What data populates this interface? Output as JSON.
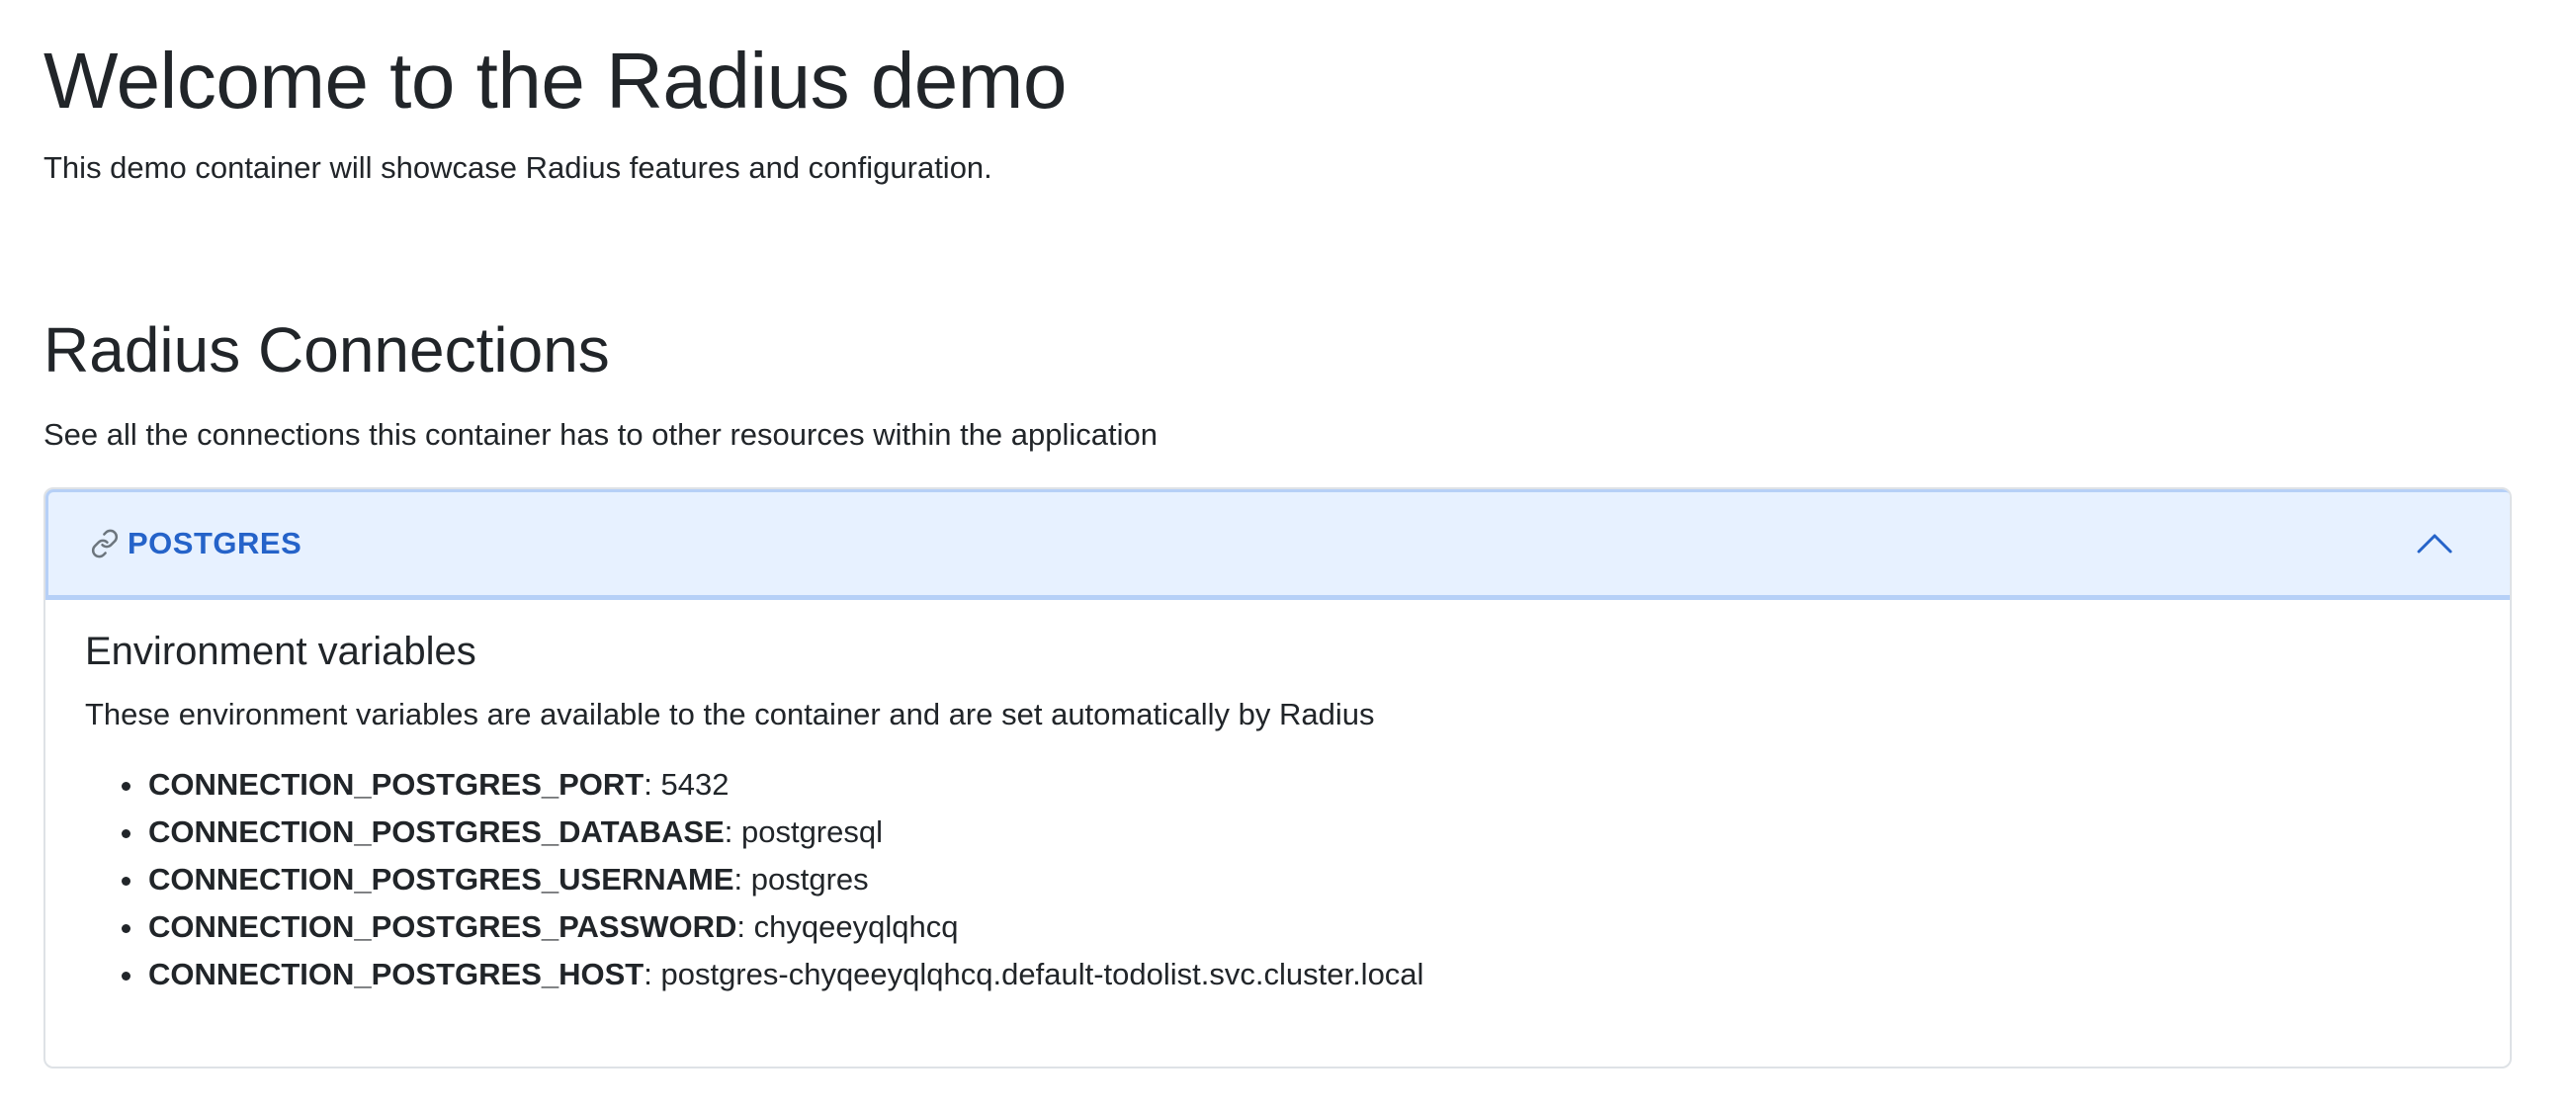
{
  "welcome": {
    "title": "Welcome to the Radius demo",
    "subtitle": "This demo container will showcase Radius features and configuration."
  },
  "connections": {
    "title": "Radius Connections",
    "subtitle": "See all the connections this container has to other resources within the application",
    "accordion": {
      "icon": "link-icon",
      "label": "POSTGRES",
      "expanded": true,
      "env_title": "Environment variables",
      "env_description": "These environment variables are available to the container and are set automatically by Radius",
      "variables": [
        {
          "key": "CONNECTION_POSTGRES_PORT",
          "value": ": 5432"
        },
        {
          "key": "CONNECTION_POSTGRES_DATABASE",
          "value": ": postgresql"
        },
        {
          "key": "CONNECTION_POSTGRES_USERNAME",
          "value": ": postgres"
        },
        {
          "key": "CONNECTION_POSTGRES_PASSWORD",
          "value": ": chyqeeyqlqhcq"
        },
        {
          "key": "CONNECTION_POSTGRES_HOST",
          "value": ": postgres-chyqeeyqlqhcq.default-todolist.svc.cluster.local"
        }
      ]
    }
  },
  "colors": {
    "text": "#212529",
    "accent": "#2563c9",
    "header_bg": "#e7f1ff",
    "header_border": "#b6d0f7"
  }
}
